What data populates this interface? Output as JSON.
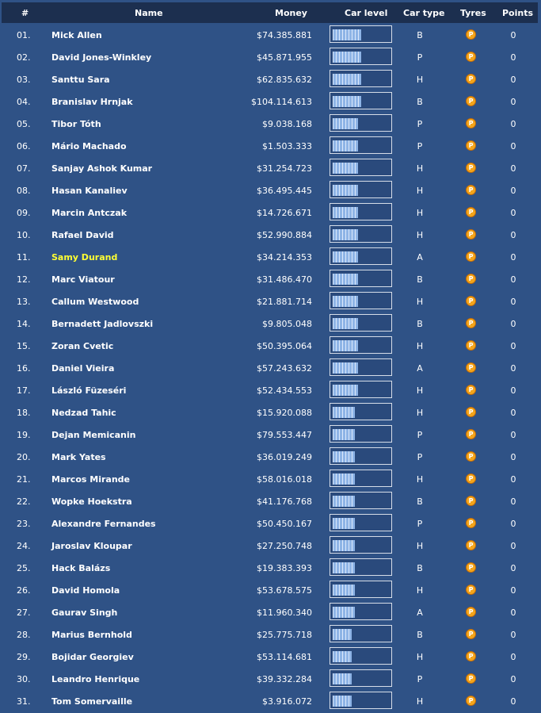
{
  "header": {
    "pos": "#",
    "name": "Name",
    "money": "Money",
    "car_level": "Car level",
    "car_type": "Car type",
    "tyres": "Tyres",
    "points": "Points"
  },
  "tyre_letter": "P",
  "highlight_color": "#ffff33",
  "rows": [
    {
      "pos": "01.",
      "name": "Mick Allen",
      "money": "$74.385.881",
      "level": 9,
      "type": "B",
      "points": "0"
    },
    {
      "pos": "02.",
      "name": "David Jones-Winkley",
      "money": "$45.871.955",
      "level": 9,
      "type": "P",
      "points": "0"
    },
    {
      "pos": "03.",
      "name": "Santtu Sara",
      "money": "$62.835.632",
      "level": 9,
      "type": "H",
      "points": "0"
    },
    {
      "pos": "04.",
      "name": "Branislav Hrnjak",
      "money": "$104.114.613",
      "level": 9,
      "type": "B",
      "points": "0"
    },
    {
      "pos": "05.",
      "name": "Tibor Tóth",
      "money": "$9.038.168",
      "level": 8,
      "type": "P",
      "points": "0"
    },
    {
      "pos": "06.",
      "name": "Mário Machado",
      "money": "$1.503.333",
      "level": 8,
      "type": "P",
      "points": "0"
    },
    {
      "pos": "07.",
      "name": "Sanjay Ashok Kumar",
      "money": "$31.254.723",
      "level": 8,
      "type": "H",
      "points": "0"
    },
    {
      "pos": "08.",
      "name": "Hasan Kanaliev",
      "money": "$36.495.445",
      "level": 8,
      "type": "H",
      "points": "0"
    },
    {
      "pos": "09.",
      "name": "Marcin Antczak",
      "money": "$14.726.671",
      "level": 8,
      "type": "H",
      "points": "0"
    },
    {
      "pos": "10.",
      "name": "Rafael David",
      "money": "$52.990.884",
      "level": 8,
      "type": "H",
      "points": "0"
    },
    {
      "pos": "11.",
      "name": "Samy Durand",
      "money": "$34.214.353",
      "level": 8,
      "type": "A",
      "points": "0",
      "highlight": true
    },
    {
      "pos": "12.",
      "name": "Marc Viatour",
      "money": "$31.486.470",
      "level": 8,
      "type": "B",
      "points": "0"
    },
    {
      "pos": "13.",
      "name": "Callum Westwood",
      "money": "$21.881.714",
      "level": 8,
      "type": "H",
      "points": "0"
    },
    {
      "pos": "14.",
      "name": "Bernadett Jadlovszki",
      "money": "$9.805.048",
      "level": 8,
      "type": "B",
      "points": "0"
    },
    {
      "pos": "15.",
      "name": "Zoran Cvetic",
      "money": "$50.395.064",
      "level": 8,
      "type": "H",
      "points": "0"
    },
    {
      "pos": "16.",
      "name": "Daniel Vieira",
      "money": "$57.243.632",
      "level": 8,
      "type": "A",
      "points": "0"
    },
    {
      "pos": "17.",
      "name": "László Füzeséri",
      "money": "$52.434.553",
      "level": 8,
      "type": "H",
      "points": "0"
    },
    {
      "pos": "18.",
      "name": "Nedzad Tahic",
      "money": "$15.920.088",
      "level": 7,
      "type": "H",
      "points": "0"
    },
    {
      "pos": "19.",
      "name": "Dejan Memicanin",
      "money": "$79.553.447",
      "level": 7,
      "type": "P",
      "points": "0"
    },
    {
      "pos": "20.",
      "name": "Mark Yates",
      "money": "$36.019.249",
      "level": 7,
      "type": "P",
      "points": "0"
    },
    {
      "pos": "21.",
      "name": "Marcos Mirande",
      "money": "$58.016.018",
      "level": 7,
      "type": "H",
      "points": "0"
    },
    {
      "pos": "22.",
      "name": "Wopke Hoekstra",
      "money": "$41.176.768",
      "level": 7,
      "type": "B",
      "points": "0"
    },
    {
      "pos": "23.",
      "name": "Alexandre Fernandes",
      "money": "$50.450.167",
      "level": 7,
      "type": "P",
      "points": "0"
    },
    {
      "pos": "24.",
      "name": "Jaroslav Kloupar",
      "money": "$27.250.748",
      "level": 7,
      "type": "H",
      "points": "0"
    },
    {
      "pos": "25.",
      "name": "Hack Balázs",
      "money": "$19.383.393",
      "level": 7,
      "type": "B",
      "points": "0"
    },
    {
      "pos": "26.",
      "name": "David Homola",
      "money": "$53.678.575",
      "level": 7,
      "type": "H",
      "points": "0"
    },
    {
      "pos": "27.",
      "name": "Gaurav Singh",
      "money": "$11.960.340",
      "level": 7,
      "type": "A",
      "points": "0"
    },
    {
      "pos": "28.",
      "name": "Marius Bernhold",
      "money": "$25.775.718",
      "level": 6,
      "type": "B",
      "points": "0"
    },
    {
      "pos": "29.",
      "name": "Bojidar Georgiev",
      "money": "$53.114.681",
      "level": 6,
      "type": "H",
      "points": "0"
    },
    {
      "pos": "30.",
      "name": "Leandro Henrique",
      "money": "$39.332.284",
      "level": 6,
      "type": "P",
      "points": "0"
    },
    {
      "pos": "31.",
      "name": "Tom Somervaille",
      "money": "$3.916.072",
      "level": 6,
      "type": "H",
      "points": "0"
    }
  ]
}
